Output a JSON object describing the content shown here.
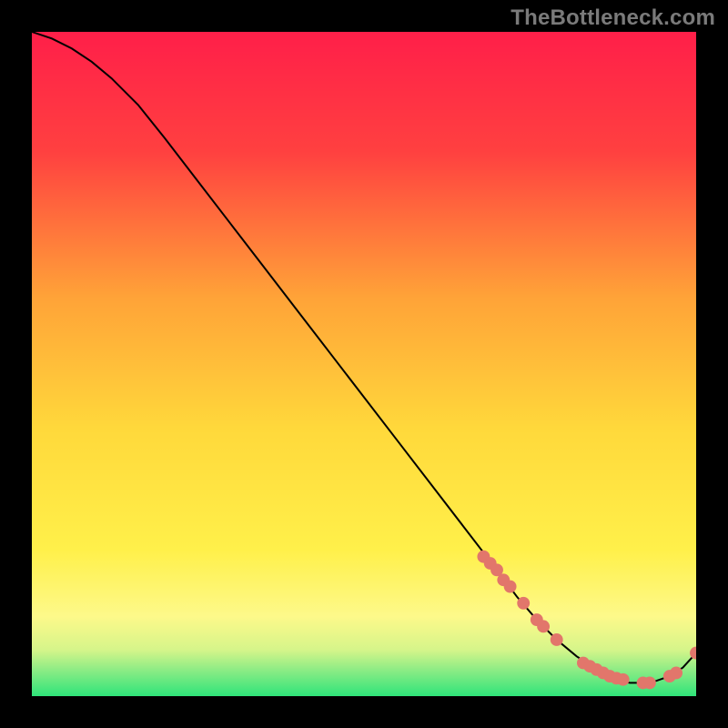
{
  "watermark": "TheBottleneck.com",
  "colors": {
    "background": "#000000",
    "watermark_text": "#7a7a7a",
    "curve": "#000000",
    "marker": "#e2766b",
    "gradient_top": "#ff1f49",
    "gradient_mid1": "#ff5a3a",
    "gradient_mid2": "#ffa338",
    "gradient_mid3": "#ffd93b",
    "gradient_mid4": "#fff04a",
    "gradient_bottom_yellow": "#fdf98a",
    "gradient_green": "#2fe47a"
  },
  "chart_data": {
    "type": "line",
    "title": "",
    "xlabel": "",
    "ylabel": "",
    "xlim": [
      0,
      100
    ],
    "ylim": [
      0,
      100
    ],
    "series": [
      {
        "name": "curve",
        "x": [
          0,
          3,
          6,
          9,
          12,
          16,
          20,
          25,
          30,
          35,
          40,
          45,
          50,
          55,
          60,
          65,
          70,
          73,
          76,
          79,
          82,
          85,
          88,
          90,
          92,
          94,
          96,
          98,
          100
        ],
        "y": [
          100,
          99,
          97.5,
          95.5,
          93,
          89,
          84,
          77.5,
          71,
          64.5,
          58,
          51.5,
          45,
          38.5,
          32,
          25.5,
          19,
          15,
          11.5,
          8.5,
          6,
          4,
          2.5,
          2,
          2,
          2.3,
          3,
          4.3,
          6.5
        ]
      }
    ],
    "markers": {
      "name": "highlight-points",
      "x": [
        68,
        69,
        70,
        71,
        72,
        74,
        76,
        77,
        79,
        83,
        84,
        85,
        86,
        87,
        88,
        89,
        92,
        93,
        96,
        97,
        100
      ],
      "y": [
        21,
        20,
        19,
        17.5,
        16.5,
        14,
        11.5,
        10.5,
        8.5,
        5,
        4.5,
        4,
        3.5,
        3,
        2.7,
        2.5,
        2,
        2,
        3,
        3.5,
        6.5
      ]
    }
  }
}
